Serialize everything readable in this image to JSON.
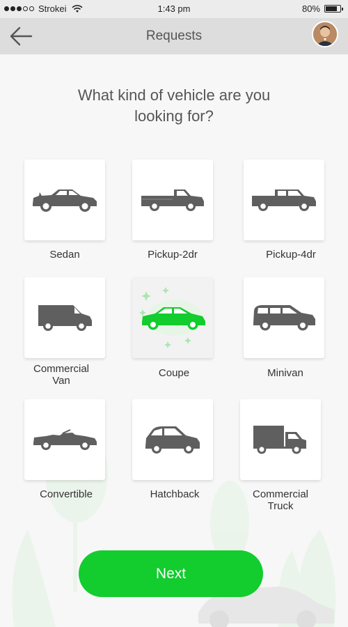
{
  "status_bar": {
    "carrier": "Strokei",
    "time": "1:43 pm",
    "battery": "80%",
    "battery_level": 0.8
  },
  "header": {
    "title": "Requests",
    "back_icon": "arrow-left-icon",
    "avatar": "user-avatar"
  },
  "question": {
    "line1": "What kind of vehicle are you",
    "line2": "looking for?"
  },
  "vehicles": [
    {
      "label": "Sedan",
      "icon": "sedan-icon",
      "selected": false
    },
    {
      "label": "Pickup-2dr",
      "icon": "pickup-2dr-icon",
      "selected": false
    },
    {
      "label": "Pickup-4dr",
      "icon": "pickup-4dr-icon",
      "selected": false
    },
    {
      "label_line1": "Commercial",
      "label_line2": "Van",
      "icon": "commercial-van-icon",
      "selected": false
    },
    {
      "label": "Coupe",
      "icon": "coupe-icon",
      "selected": true
    },
    {
      "label": "Minivan",
      "icon": "minivan-icon",
      "selected": false
    },
    {
      "label": "Convertible",
      "icon": "convertible-icon",
      "selected": false
    },
    {
      "label": "Hatchback",
      "icon": "hatchback-icon",
      "selected": false
    },
    {
      "label_line1": "Commercial",
      "label_line2": "Truck",
      "icon": "commercial-truck-icon",
      "selected": false
    }
  ],
  "next_button": {
    "label": "Next"
  },
  "colors": {
    "accent": "#13cc2e",
    "icon_gray": "#5f5f5f",
    "header_bg": "#dddddd"
  }
}
